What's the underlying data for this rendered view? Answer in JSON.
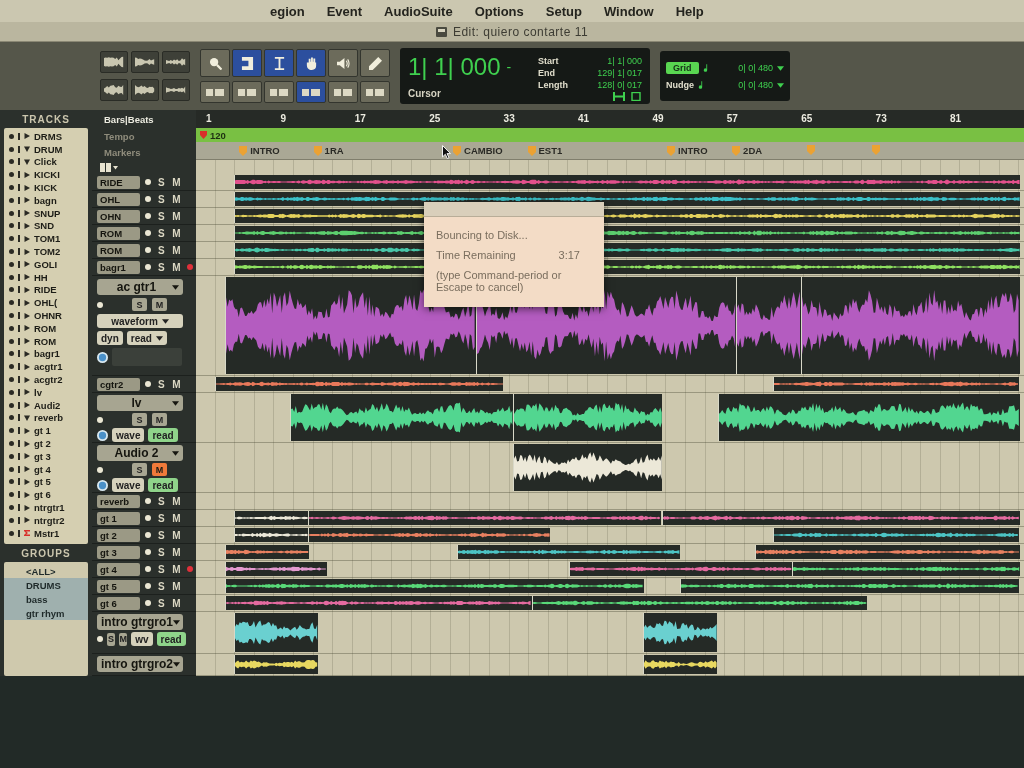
{
  "menu_bar": {
    "items": [
      "egion",
      "Event",
      "AudioSuite",
      "Options",
      "Setup",
      "Window",
      "Help"
    ]
  },
  "edit_window": {
    "title": "Edit: quiero contarte 11"
  },
  "toolbar": {
    "tools": [
      {
        "kind": "zoom",
        "selected": false
      },
      {
        "kind": "trim",
        "selected": true
      },
      {
        "kind": "select",
        "selected": true
      },
      {
        "kind": "grab",
        "selected": true
      },
      {
        "kind": "scrub",
        "selected": false
      },
      {
        "kind": "pencil",
        "selected": false
      }
    ],
    "modes": [
      {
        "selected": false
      },
      {
        "selected": false
      },
      {
        "selected": false
      },
      {
        "selected": true
      },
      {
        "selected": false
      },
      {
        "selected": false
      }
    ]
  },
  "counter": {
    "main": "1| 1| 000",
    "sign": "-",
    "label": "Cursor",
    "fields": [
      {
        "label": "Start",
        "value": "1| 1| 000"
      },
      {
        "label": "End",
        "value": "129| 1| 017"
      },
      {
        "label": "Length",
        "value": "128| 0| 017"
      }
    ]
  },
  "grid_nudge": {
    "grid": {
      "label": "Grid",
      "on": true,
      "value": "0| 0| 480"
    },
    "nudge": {
      "label": "Nudge",
      "value": "0| 0| 480"
    }
  },
  "rulers": {
    "labels": [
      "Bars|Beats",
      "Tempo",
      "Markers"
    ],
    "bars": [
      "1",
      "9",
      "17",
      "25",
      "33",
      "41",
      "49",
      "57",
      "65",
      "73",
      "81"
    ],
    "tempo": "120",
    "markers": [
      {
        "kind": "labeled",
        "label": "INTRO"
      },
      {
        "kind": "labeled",
        "label": "1RA"
      },
      {
        "kind": "labeled",
        "label": "CAMBIO"
      },
      {
        "kind": "labeled",
        "label": "EST1"
      },
      {
        "kind": "labeled",
        "label": "INTRO"
      },
      {
        "kind": "labeled",
        "label": "2DA"
      },
      {
        "kind": "bare"
      },
      {
        "kind": "bare"
      }
    ]
  },
  "track_list": {
    "title": "TRACKS",
    "items": [
      {
        "name": "DRMS",
        "kind": "audio",
        "expanded": false
      },
      {
        "name": "DRUM",
        "kind": "audio",
        "expanded": true
      },
      {
        "name": "Click",
        "kind": "audio",
        "expanded": true
      },
      {
        "name": "KICKI",
        "kind": "audio",
        "expanded": false
      },
      {
        "name": "KICK",
        "kind": "audio",
        "expanded": false
      },
      {
        "name": "bagn",
        "kind": "audio",
        "expanded": false
      },
      {
        "name": "SNUP",
        "kind": "audio",
        "expanded": false
      },
      {
        "name": "SND",
        "kind": "audio",
        "expanded": false
      },
      {
        "name": "TOM1",
        "kind": "audio",
        "expanded": false
      },
      {
        "name": "TOM2",
        "kind": "audio",
        "expanded": false
      },
      {
        "name": "GOLI",
        "kind": "audio",
        "expanded": false
      },
      {
        "name": "HH",
        "kind": "audio",
        "expanded": false
      },
      {
        "name": "RIDE",
        "kind": "audio",
        "expanded": false
      },
      {
        "name": "OHL(",
        "kind": "audio",
        "expanded": false
      },
      {
        "name": "OHNR",
        "kind": "audio",
        "expanded": false
      },
      {
        "name": "ROM",
        "kind": "audio",
        "expanded": false
      },
      {
        "name": "ROM",
        "kind": "audio",
        "expanded": false
      },
      {
        "name": "bagr1",
        "kind": "audio",
        "expanded": false
      },
      {
        "name": "acgtr1",
        "kind": "audio",
        "expanded": false
      },
      {
        "name": "acgtr2",
        "kind": "audio",
        "expanded": false
      },
      {
        "name": "lv",
        "kind": "audio",
        "expanded": false
      },
      {
        "name": "Audi2",
        "kind": "audio",
        "expanded": false
      },
      {
        "name": "reverb",
        "kind": "audio",
        "expanded": true
      },
      {
        "name": "gt 1",
        "kind": "audio",
        "expanded": false
      },
      {
        "name": "gt 2",
        "kind": "audio",
        "expanded": false
      },
      {
        "name": "gt 3",
        "kind": "audio",
        "expanded": false
      },
      {
        "name": "gt 4",
        "kind": "audio",
        "expanded": false
      },
      {
        "name": "gt 5",
        "kind": "audio",
        "expanded": false
      },
      {
        "name": "gt 6",
        "kind": "audio",
        "expanded": false
      },
      {
        "name": "ntrgtr1",
        "kind": "audio",
        "expanded": false
      },
      {
        "name": "ntrgtr2",
        "kind": "audio",
        "expanded": false
      },
      {
        "name": "Mstr1",
        "kind": "master"
      }
    ]
  },
  "groups": {
    "title": "GROUPS",
    "items": [
      {
        "name": "<ALL>",
        "active": false
      },
      {
        "name": "DRUMS",
        "active": true
      },
      {
        "name": "bass",
        "active": true
      },
      {
        "name": "gtr rhym",
        "active": true
      }
    ]
  },
  "tracks": [
    {
      "kind": "mini",
      "name": "RIDE",
      "solo": "S",
      "mute": "M",
      "muted": false,
      "armed": false,
      "clips": [
        {
          "color": "#e2508c"
        }
      ]
    },
    {
      "kind": "mini",
      "name": "OHL",
      "solo": "S",
      "mute": "M",
      "muted": false,
      "armed": false,
      "clips": [
        {
          "color": "#3cc0c8"
        }
      ]
    },
    {
      "kind": "mini",
      "name": "OHN",
      "solo": "S",
      "mute": "M",
      "muted": false,
      "armed": false,
      "clips": [
        {
          "color": "#e4d25c"
        }
      ]
    },
    {
      "kind": "mini",
      "name": "ROM",
      "solo": "S",
      "mute": "M",
      "muted": false,
      "armed": false,
      "clips": [
        {
          "color": "#5ccf6e"
        }
      ]
    },
    {
      "kind": "mini",
      "name": "ROM",
      "solo": "S",
      "mute": "M",
      "muted": false,
      "armed": false,
      "clips": [
        {
          "color": "#48c6a8"
        }
      ]
    },
    {
      "kind": "mini",
      "name": "bagr1",
      "solo": "S",
      "mute": "M",
      "muted": false,
      "armed": true,
      "clips": [
        {
          "color": "#8ee060"
        }
      ]
    },
    {
      "kind": "large",
      "name": "ac gtr1",
      "solo": "S",
      "mute": "M",
      "muted": false,
      "armed": false,
      "view": "waveform",
      "dyn": "dyn",
      "automation": "read",
      "clips": [
        {
          "color": "#b45cc0"
        },
        {
          "color": "#b45cc0"
        },
        {
          "color": "#b45cc0"
        },
        {
          "color": "#b45cc0"
        }
      ]
    },
    {
      "kind": "mini",
      "name": "cgtr2",
      "solo": "S",
      "mute": "M",
      "muted": false,
      "armed": false,
      "clips": [
        {
          "color": "#e8785a"
        },
        {
          "color": "#e8785a"
        }
      ]
    },
    {
      "kind": "medium",
      "name": "lv",
      "solo": "S",
      "mute": "M",
      "muted": false,
      "armed": false,
      "view": "wave",
      "automation": "read",
      "clips": [
        {
          "color": "#52d690"
        },
        {
          "color": "#52d690"
        },
        {
          "color": "#52d690"
        }
      ]
    },
    {
      "kind": "medium",
      "name": "Audio 2",
      "solo": "S",
      "mute": "M",
      "muted": true,
      "armed": false,
      "view": "wave",
      "automation": "read",
      "clips": [
        {
          "color": "#ece8d8"
        }
      ]
    },
    {
      "kind": "mini",
      "name": "reverb",
      "solo": "S",
      "mute": "M",
      "muted": false,
      "armed": false
    },
    {
      "kind": "mini",
      "name": "gt 1",
      "solo": "S",
      "mute": "M",
      "muted": false,
      "armed": false,
      "clips": [
        {
          "color": "#ece8d8"
        },
        {
          "color": "#e46aa0"
        },
        {
          "color": "#e46aa0"
        }
      ]
    },
    {
      "kind": "mini",
      "name": "gt 2",
      "solo": "S",
      "mute": "M",
      "muted": false,
      "armed": false,
      "clips": [
        {
          "color": "#ece8d8"
        },
        {
          "color": "#e88060"
        },
        {
          "color": "#4cc4c4"
        }
      ]
    },
    {
      "kind": "mini",
      "name": "gt 3",
      "solo": "S",
      "mute": "M",
      "muted": false,
      "armed": false,
      "clips": [
        {
          "color": "#e88060"
        },
        {
          "color": "#4cc4c4"
        },
        {
          "color": "#e88060"
        }
      ]
    },
    {
      "kind": "mini",
      "name": "gt 4",
      "solo": "S",
      "mute": "M",
      "muted": false,
      "armed": true,
      "clips": [
        {
          "color": "#e49ad0"
        },
        {
          "color": "#e46aa0"
        },
        {
          "color": "#58d878"
        }
      ]
    },
    {
      "kind": "mini",
      "name": "gt 5",
      "solo": "S",
      "mute": "M",
      "muted": false,
      "armed": false,
      "clips": [
        {
          "color": "#58d878"
        },
        {
          "color": "#58d878"
        }
      ]
    },
    {
      "kind": "mini",
      "name": "gt 6",
      "solo": "S",
      "mute": "M",
      "muted": false,
      "armed": false,
      "clips": [
        {
          "color": "#e46aa0"
        },
        {
          "color": "#58d878"
        }
      ]
    },
    {
      "kind": "small",
      "name": "intro gtrgro1",
      "solo": "S",
      "mute": "M",
      "muted": false,
      "armed": false,
      "view": "wv",
      "automation": "read",
      "clips": [
        {
          "color": "#6ad0d0"
        },
        {
          "color": "#6ad0d0"
        }
      ]
    },
    {
      "kind": "stub",
      "name": "intro gtrgro2",
      "clips": [
        {
          "color": "#e8d860"
        },
        {
          "color": "#e8d860"
        }
      ]
    }
  ],
  "bounce_dialog": {
    "message": "Bouncing to Disk...",
    "label": "Time Remaining",
    "value": "3:17",
    "hint": "(type Command-period or Escape to cancel)"
  }
}
